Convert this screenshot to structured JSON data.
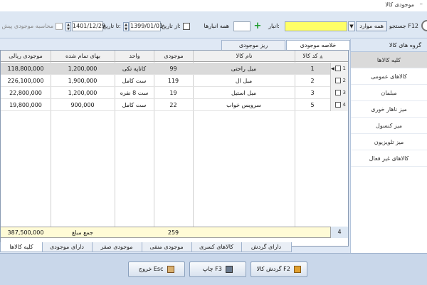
{
  "window": {
    "title": "موجودی کالا",
    "minimize_glyph": "–"
  },
  "toolbar": {
    "search_label": "جستجو F12",
    "all_items_button": "همه موارد",
    "warehouse_label": "انبار:",
    "all_warehouses_label": "همه انبارها",
    "from_date_label": "از تاریخ:",
    "from_date_value": "1399/01/01",
    "to_date_label": "تا تاریخ:",
    "to_date_value": "1401/12/29",
    "calc_prev_label": "محاسبه موجودی پیش از با"
  },
  "right_panel": {
    "header": "گروه های کالا",
    "items": [
      {
        "label": "کلیه کالاها",
        "active": true
      },
      {
        "label": "کالاهای عمومی",
        "active": false
      },
      {
        "label": "مبلمان",
        "active": false
      },
      {
        "label": "میز ناهار خوری",
        "active": false
      },
      {
        "label": "میز کنسول",
        "active": false
      },
      {
        "label": "میز تلویزیون",
        "active": false
      },
      {
        "label": "کالاهای غیر فعال",
        "active": false
      }
    ]
  },
  "top_tabs": [
    "خلاصه موجودی",
    "ریز موجودی"
  ],
  "grid": {
    "headers": {
      "code": "کد کالا",
      "name": "نام کالا",
      "stock": "موجودی",
      "unit": "واحد",
      "price": "بهای تمام شده",
      "value": "موجودی ریالی"
    },
    "rows": [
      {
        "rownum": "1",
        "code": "1",
        "name": "مبل راحتی",
        "stock": "99",
        "unit": "کاناپه تکی",
        "price": "1,200,000",
        "value": "118,800,000"
      },
      {
        "rownum": "2",
        "code": "2",
        "name": "مبل ال",
        "stock": "119",
        "unit": "ست کامل",
        "price": "1,900,000",
        "value": "226,100,000"
      },
      {
        "rownum": "3",
        "code": "3",
        "name": "مبل استیل",
        "stock": "19",
        "unit": "ست 8 نفره",
        "price": "1,200,000",
        "value": "22,800,000"
      },
      {
        "rownum": "4",
        "code": "5",
        "name": "سرویس خواب",
        "stock": "22",
        "unit": "ست کامل",
        "price": "900,000",
        "value": "19,800,000"
      }
    ],
    "footer": {
      "count": "4",
      "stock_total": "259",
      "label": "جمع مبلغ",
      "value_total": "387,500,000"
    }
  },
  "bottom_tabs": [
    "دارای گردش",
    "کالاهای کسری",
    "موجودی منفی",
    "موجودی صفر",
    "دارای موجودی",
    "کلیه کالاها"
  ],
  "bottom_buttons": {
    "turnover": "گردش کالا F2",
    "print": "چاپ F3",
    "exit": "خروج Esc"
  }
}
